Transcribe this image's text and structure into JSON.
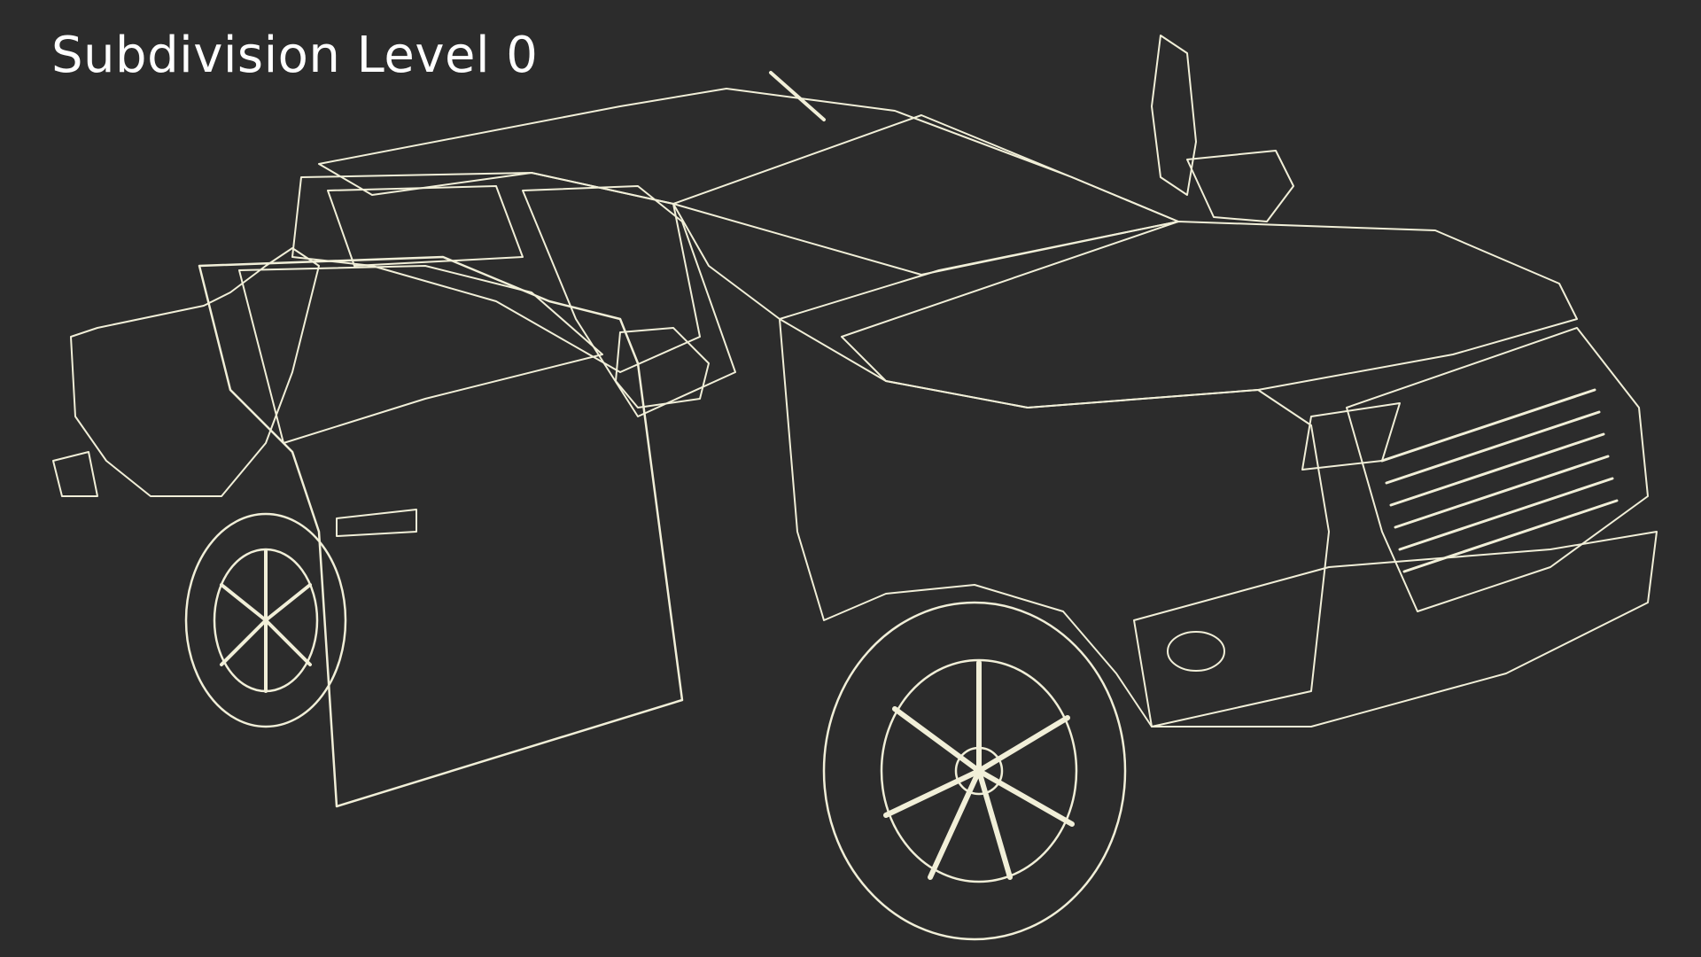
{
  "caption": {
    "text": "Subdivision Level 0"
  },
  "colors": {
    "background": "#2c2c2c",
    "mesh_surface": "#76766b",
    "wire_lines": "#f1efd8",
    "caption_text": "#ffffff"
  },
  "model": {
    "subject": "pickup-truck-wireframe",
    "view": "front-left three-quarter, doors open"
  }
}
